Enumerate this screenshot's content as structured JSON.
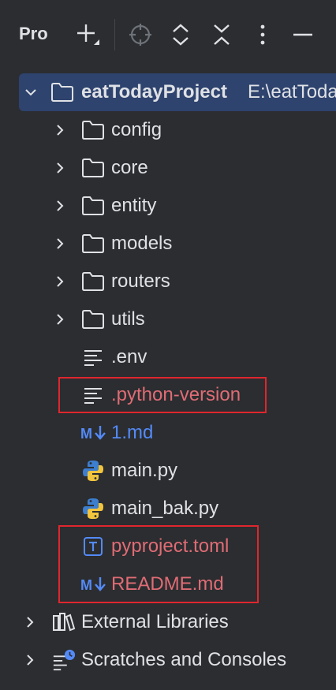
{
  "toolbar": {
    "title": "Pro",
    "icons": [
      "add-icon",
      "locate-icon",
      "expand-icon",
      "collapse-icon",
      "more-icon",
      "minimize-icon"
    ]
  },
  "tree": {
    "root": {
      "name": "eatTodayProject",
      "path": "E:\\eatToda"
    },
    "folders": [
      "config",
      "core",
      "entity",
      "models",
      "routers",
      "utils"
    ],
    "files": [
      {
        "name": ".env",
        "icon": "text-file-icon"
      },
      {
        "name": ".python-version",
        "icon": "text-file-icon"
      },
      {
        "name": "1.md",
        "icon": "markdown-icon"
      },
      {
        "name": "main.py",
        "icon": "python-icon"
      },
      {
        "name": "main_bak.py",
        "icon": "python-icon"
      },
      {
        "name": "pyproject.toml",
        "icon": "toml-icon"
      },
      {
        "name": "README.md",
        "icon": "markdown-icon"
      }
    ],
    "external_libraries": "External Libraries",
    "scratches": "Scratches and Consoles"
  },
  "colors": {
    "background": "#2b2d30",
    "selection": "#2e436e",
    "text": "#dfe1e5",
    "markdown_text": "#548af7",
    "highlight_text": "#e06c75",
    "annotation_box": "#e0262e"
  }
}
